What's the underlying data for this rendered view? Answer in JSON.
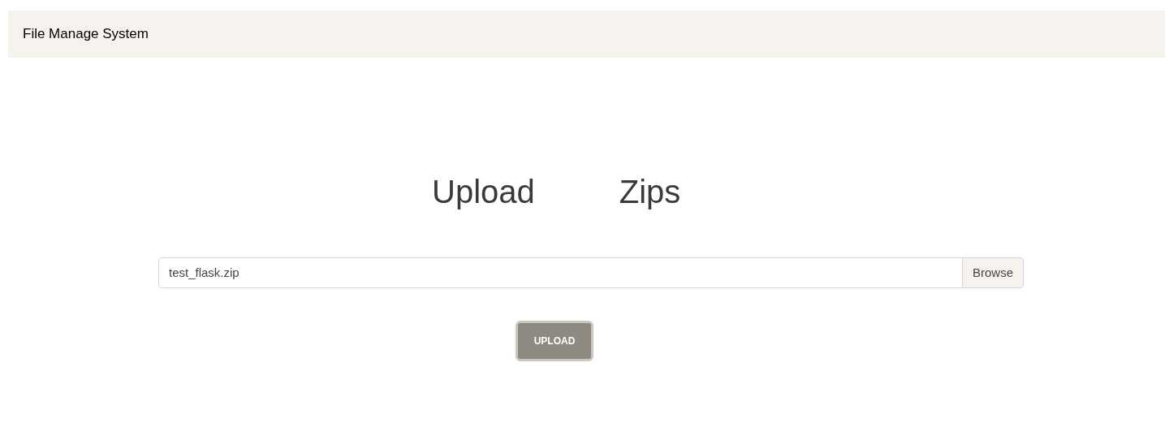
{
  "navbar": {
    "brand": "File Manage System"
  },
  "heading": [
    "Upload",
    "Zips"
  ],
  "file_input": {
    "value": "test_flask.zip",
    "button": "Browse"
  },
  "upload_button": "UPLOAD"
}
